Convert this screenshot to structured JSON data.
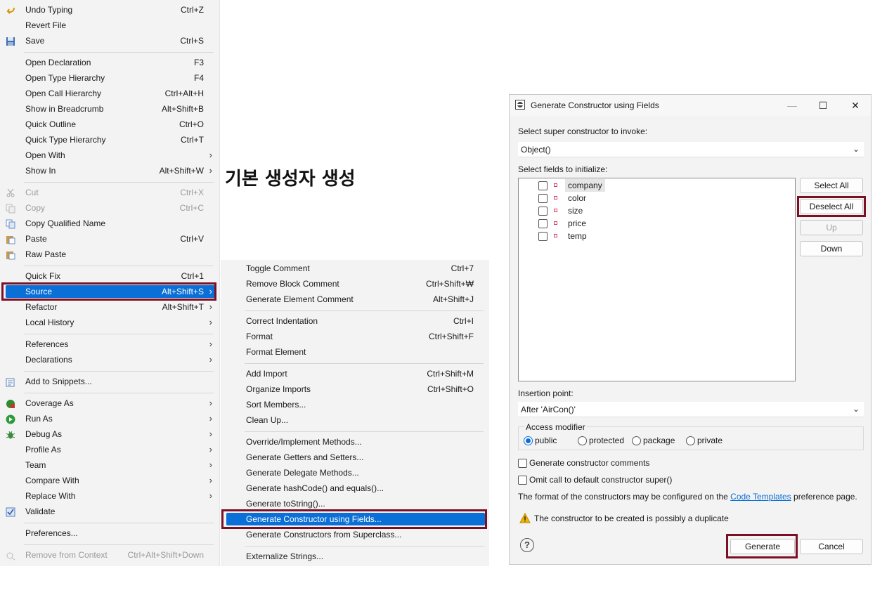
{
  "context_menu": {
    "items": [
      {
        "label": "Undo Typing",
        "shortcut": "Ctrl+Z",
        "icon": "undo-icon"
      },
      {
        "label": "Revert File",
        "shortcut": ""
      },
      {
        "label": "Save",
        "shortcut": "Ctrl+S",
        "icon": "save-icon"
      },
      {
        "label": "Open Declaration",
        "shortcut": "F3"
      },
      {
        "label": "Open Type Hierarchy",
        "shortcut": "F4"
      },
      {
        "label": "Open Call Hierarchy",
        "shortcut": "Ctrl+Alt+H"
      },
      {
        "label": "Show in Breadcrumb",
        "shortcut": "Alt+Shift+B"
      },
      {
        "label": "Quick Outline",
        "shortcut": "Ctrl+O"
      },
      {
        "label": "Quick Type Hierarchy",
        "shortcut": "Ctrl+T"
      },
      {
        "label": "Open With",
        "shortcut": "",
        "arrow": "›"
      },
      {
        "label": "Show In",
        "shortcut": "Alt+Shift+W",
        "arrow": "›"
      },
      {
        "label": "Cut",
        "shortcut": "Ctrl+X",
        "icon": "scissors-icon"
      },
      {
        "label": "Copy",
        "shortcut": "Ctrl+C",
        "icon": "copy-icon"
      },
      {
        "label": "Copy Qualified Name",
        "shortcut": "",
        "icon": "copy-qualified-icon"
      },
      {
        "label": "Paste",
        "shortcut": "Ctrl+V",
        "icon": "paste-icon"
      },
      {
        "label": "Raw Paste",
        "shortcut": "",
        "icon": "raw-paste-icon"
      },
      {
        "label": "Quick Fix",
        "shortcut": "Ctrl+1"
      },
      {
        "label": "Source",
        "shortcut": "Alt+Shift+S",
        "arrow": "›"
      },
      {
        "label": "Refactor",
        "shortcut": "Alt+Shift+T",
        "arrow": "›"
      },
      {
        "label": "Local History",
        "shortcut": "",
        "arrow": "›"
      },
      {
        "label": "References",
        "shortcut": "",
        "arrow": "›"
      },
      {
        "label": "Declarations",
        "shortcut": "",
        "arrow": "›"
      },
      {
        "label": "Add to Snippets...",
        "shortcut": "",
        "icon": "snippets-icon"
      },
      {
        "label": "Coverage As",
        "shortcut": "",
        "arrow": "›",
        "icon": "coverage-icon"
      },
      {
        "label": "Run As",
        "shortcut": "",
        "arrow": "›",
        "icon": "run-icon"
      },
      {
        "label": "Debug As",
        "shortcut": "",
        "arrow": "›",
        "icon": "debug-bug-icon"
      },
      {
        "label": "Profile As",
        "shortcut": "",
        "arrow": "›"
      },
      {
        "label": "Team",
        "shortcut": "",
        "arrow": "›"
      },
      {
        "label": "Compare With",
        "shortcut": "",
        "arrow": "›"
      },
      {
        "label": "Replace With",
        "shortcut": "",
        "arrow": "›"
      },
      {
        "label": "Validate",
        "shortcut": "",
        "icon": "checkbox-checked-icon"
      },
      {
        "label": "Preferences...",
        "shortcut": ""
      },
      {
        "label": "Remove from Context",
        "shortcut": "Ctrl+Alt+Shift+Down",
        "icon": "remove-context-icon"
      }
    ]
  },
  "caption": "기본 생성자 생성",
  "source_submenu": {
    "items": [
      {
        "label": "Toggle Comment",
        "shortcut": "Ctrl+7"
      },
      {
        "label": "Remove Block Comment",
        "shortcut": "Ctrl+Shift+₩"
      },
      {
        "label": "Generate Element Comment",
        "shortcut": "Alt+Shift+J"
      },
      {
        "label": "Correct Indentation",
        "shortcut": "Ctrl+I"
      },
      {
        "label": "Format",
        "shortcut": "Ctrl+Shift+F"
      },
      {
        "label": "Format Element",
        "shortcut": ""
      },
      {
        "label": "Add Import",
        "shortcut": "Ctrl+Shift+M"
      },
      {
        "label": "Organize Imports",
        "shortcut": "Ctrl+Shift+O"
      },
      {
        "label": "Sort Members...",
        "shortcut": ""
      },
      {
        "label": "Clean Up...",
        "shortcut": ""
      },
      {
        "label": "Override/Implement Methods...",
        "shortcut": ""
      },
      {
        "label": "Generate Getters and Setters...",
        "shortcut": ""
      },
      {
        "label": "Generate Delegate Methods...",
        "shortcut": ""
      },
      {
        "label": "Generate hashCode() and equals()...",
        "shortcut": ""
      },
      {
        "label": "Generate toString()...",
        "shortcut": ""
      },
      {
        "label": "Generate Constructor using Fields...",
        "shortcut": ""
      },
      {
        "label": "Generate Constructors from Superclass...",
        "shortcut": ""
      },
      {
        "label": "Externalize Strings...",
        "shortcut": ""
      }
    ]
  },
  "dialog": {
    "title": "Generate Constructor using Fields",
    "minimize": "—",
    "maximize": "☐",
    "close": "✕",
    "super_label": "Select super constructor to invoke:",
    "super_value": "Object()",
    "fields_label": "Select fields to initialize:",
    "fields": [
      "company",
      "color",
      "size",
      "price",
      "temp"
    ],
    "select_all": "Select All",
    "deselect_all": "Deselect All",
    "up": "Up",
    "down": "Down",
    "insertion_label": "Insertion point:",
    "insertion_value": "After 'AirCon()'",
    "access_label": "Access modifier",
    "access_options": [
      "public",
      "protected",
      "package",
      "private"
    ],
    "access_selected": "public",
    "gen_comments": "Generate constructor comments",
    "omit_super": "Omit call to default constructor super()",
    "note_pre": "The format of the constructors may be configured on the",
    "note_link": "Code Templates",
    "note_post": "preference page.",
    "warning": "The constructor to be created is possibly a duplicate",
    "help": "?",
    "generate": "Generate",
    "cancel": "Cancel",
    "colors": {
      "accent": "#0a6fd6",
      "highlight_box": "#7b1025",
      "warning": "#f2b400"
    }
  }
}
